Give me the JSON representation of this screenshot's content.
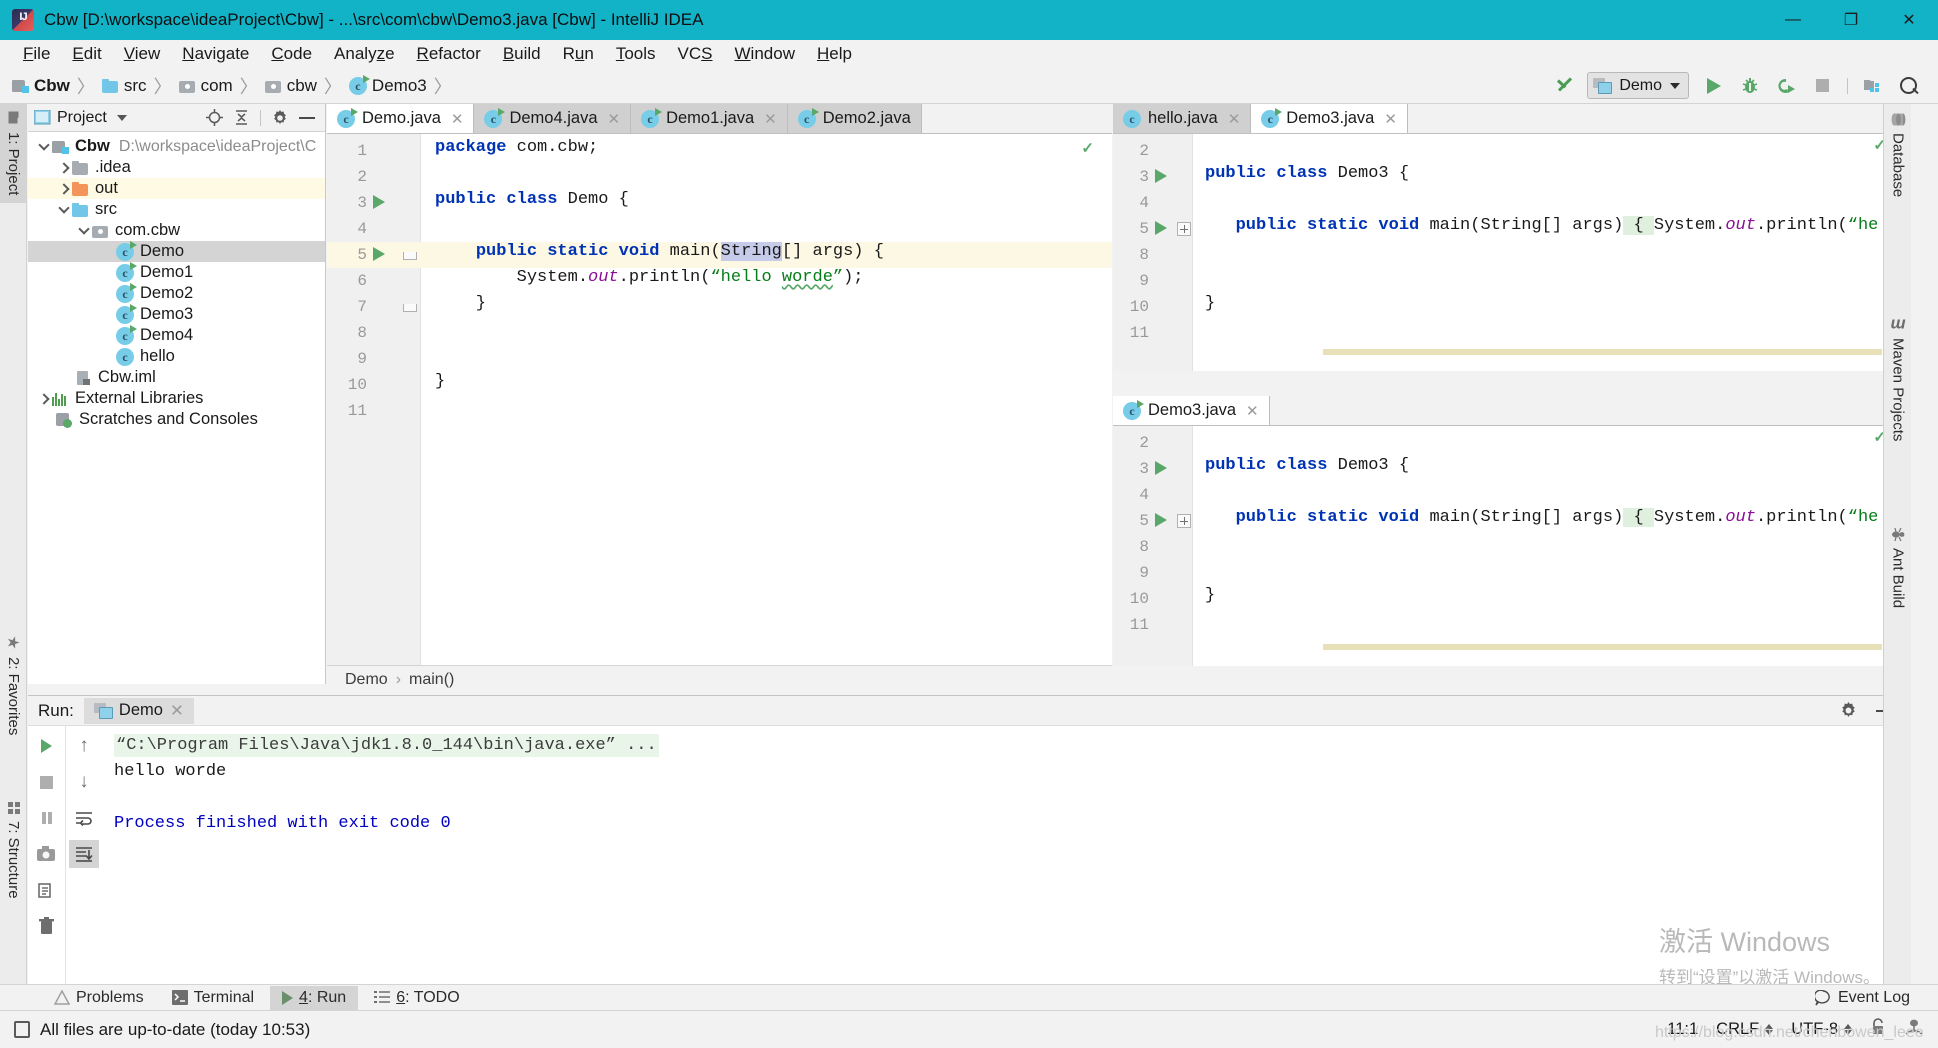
{
  "window": {
    "title": "Cbw [D:\\workspace\\ideaProject\\Cbw] - ...\\src\\com\\cbw\\Demo3.java [Cbw] - IntelliJ IDEA",
    "app_icon": "intellij-idea-icon",
    "minimize": "—",
    "maximize": "❐",
    "close": "✕",
    "titlebar_color": "#12b3c6"
  },
  "menu": {
    "items": [
      {
        "label": "File"
      },
      {
        "label": "Edit"
      },
      {
        "label": "View"
      },
      {
        "label": "Navigate"
      },
      {
        "label": "Code"
      },
      {
        "label": "Analyze"
      },
      {
        "label": "Refactor"
      },
      {
        "label": "Build"
      },
      {
        "label": "Run"
      },
      {
        "label": "Tools"
      },
      {
        "label": "VCS"
      },
      {
        "label": "Window"
      },
      {
        "label": "Help"
      }
    ]
  },
  "navbar": {
    "breadcrumbs": [
      {
        "label": "Cbw",
        "icon": "module-icon",
        "bold": true
      },
      {
        "label": "src",
        "icon": "source-folder-icon",
        "bold": false
      },
      {
        "label": "com",
        "icon": "package-icon",
        "bold": false
      },
      {
        "label": "cbw",
        "icon": "package-icon",
        "bold": false
      },
      {
        "label": "Demo3",
        "icon": "java-class-icon",
        "bold": false
      }
    ],
    "separator": "〉",
    "toolbar": {
      "update_project_label": "update-project-icon",
      "run_configuration": "Demo",
      "run_button": "run-icon",
      "debug_button": "debug-icon",
      "coverage_button": "run-with-coverage-icon",
      "stop_button": "stop-icon",
      "project_structure_button": "project-structure-icon",
      "search_button": "search-everywhere-icon"
    }
  },
  "left_tool_strip": {
    "tabs": [
      {
        "label": "1: Project",
        "icon": "project-folder-icon",
        "active": true
      },
      {
        "label": "2: Favorites",
        "icon": "star-icon",
        "active": false
      },
      {
        "label": "7: Structure",
        "icon": "structure-icon",
        "active": false
      }
    ]
  },
  "right_tool_strip": {
    "tabs": [
      {
        "label": "Database",
        "icon": "database-icon"
      },
      {
        "label": "Maven Projects",
        "icon": "maven-icon"
      },
      {
        "label": "Ant Build",
        "icon": "ant-icon"
      }
    ]
  },
  "project_panel": {
    "title": "Project",
    "dropdown_icon": "chevron-down-icon",
    "tools": [
      {
        "name": "locate-icon"
      },
      {
        "name": "collapse-all-icon"
      },
      {
        "name": "settings-gear-icon"
      },
      {
        "name": "hide-icon"
      }
    ],
    "tree": [
      {
        "label": "Cbw",
        "path": "D:\\workspace\\ideaProject\\C",
        "icon": "module-icon",
        "indent": 0,
        "twisty": "down",
        "bold": true,
        "state": "normal"
      },
      {
        "label": ".idea",
        "path": "",
        "icon": "folder-gray-icon",
        "indent": 1,
        "twisty": "right",
        "bold": false,
        "state": "normal"
      },
      {
        "label": "out",
        "path": "",
        "icon": "folder-orange-icon",
        "indent": 1,
        "twisty": "right",
        "bold": false,
        "state": "highlight"
      },
      {
        "label": "src",
        "path": "",
        "icon": "folder-blue-icon",
        "indent": 1,
        "twisty": "down",
        "bold": false,
        "state": "normal"
      },
      {
        "label": "com.cbw",
        "path": "",
        "icon": "package-icon",
        "indent": 2,
        "twisty": "down",
        "bold": false,
        "state": "normal"
      },
      {
        "label": "Demo",
        "path": "",
        "icon": "java-class-runnable-icon",
        "indent": 3,
        "twisty": "",
        "bold": false,
        "state": "selected"
      },
      {
        "label": "Demo1",
        "path": "",
        "icon": "java-class-runnable-icon",
        "indent": 3,
        "twisty": "",
        "bold": false,
        "state": "normal"
      },
      {
        "label": "Demo2",
        "path": "",
        "icon": "java-class-runnable-icon",
        "indent": 3,
        "twisty": "",
        "bold": false,
        "state": "normal"
      },
      {
        "label": "Demo3",
        "path": "",
        "icon": "java-class-runnable-icon",
        "indent": 3,
        "twisty": "",
        "bold": false,
        "state": "normal"
      },
      {
        "label": "Demo4",
        "path": "",
        "icon": "java-class-runnable-icon",
        "indent": 3,
        "twisty": "",
        "bold": false,
        "state": "normal"
      },
      {
        "label": "hello",
        "path": "",
        "icon": "java-class-icon",
        "indent": 3,
        "twisty": "",
        "bold": false,
        "state": "normal"
      },
      {
        "label": "Cbw.iml",
        "path": "",
        "icon": "iml-file-icon",
        "indent": 2,
        "twisty": "",
        "bold": false,
        "state": "normal"
      },
      {
        "label": "External Libraries",
        "path": "",
        "icon": "library-icon",
        "indent": 0,
        "twisty": "right",
        "bold": false,
        "state": "normal"
      },
      {
        "label": "Scratches and Consoles",
        "path": "",
        "icon": "scratches-icon",
        "indent": 1,
        "twisty": "",
        "bold": false,
        "state": "normal"
      }
    ]
  },
  "editor_left": {
    "tabs": [
      {
        "label": "Demo.java",
        "icon": "java-class-runnable-icon",
        "active": true,
        "close": "✕"
      },
      {
        "label": "Demo4.java",
        "icon": "java-class-runnable-icon",
        "active": false,
        "close": "✕"
      },
      {
        "label": "Demo1.java",
        "icon": "java-class-runnable-icon",
        "active": false,
        "close": "✕"
      },
      {
        "label": "Demo2.java",
        "icon": "java-class-runnable-icon",
        "active": false,
        "close": "✕"
      }
    ],
    "lines": [
      {
        "num": "1",
        "gutter_run": false,
        "fold": "",
        "highlight": false,
        "tokens": [
          {
            "t": "package",
            "c": "kw"
          },
          {
            "t": " com.cbw;",
            "c": "plain"
          }
        ]
      },
      {
        "num": "2",
        "gutter_run": false,
        "fold": "",
        "highlight": false,
        "tokens": []
      },
      {
        "num": "3",
        "gutter_run": true,
        "fold": "",
        "highlight": false,
        "tokens": [
          {
            "t": "public class",
            "c": "kw"
          },
          {
            "t": " Demo {",
            "c": "plain"
          }
        ]
      },
      {
        "num": "4",
        "gutter_run": false,
        "fold": "",
        "highlight": false,
        "tokens": []
      },
      {
        "num": "5",
        "gutter_run": true,
        "fold": "tip",
        "highlight": true,
        "tokens": [
          {
            "t": "    ",
            "c": "plain"
          },
          {
            "t": "public static void",
            "c": "kw"
          },
          {
            "t": " main(",
            "c": "plain"
          },
          {
            "t": "String",
            "c": "sel-blue"
          },
          {
            "t": "[] args) {",
            "c": "plain"
          }
        ]
      },
      {
        "num": "6",
        "gutter_run": false,
        "fold": "",
        "highlight": false,
        "tokens": [
          {
            "t": "        System.",
            "c": "plain"
          },
          {
            "t": "out",
            "c": "field-it"
          },
          {
            "t": ".println(",
            "c": "plain"
          },
          {
            "t": "“hello ",
            "c": "str"
          },
          {
            "t": "worde",
            "c": "str squiggle"
          },
          {
            "t": "”",
            "c": "str"
          },
          {
            "t": ");",
            "c": "plain"
          }
        ]
      },
      {
        "num": "7",
        "gutter_run": false,
        "fold": "tip",
        "highlight": false,
        "tokens": [
          {
            "t": "    }",
            "c": "plain"
          }
        ]
      },
      {
        "num": "8",
        "gutter_run": false,
        "fold": "",
        "highlight": false,
        "tokens": []
      },
      {
        "num": "9",
        "gutter_run": false,
        "fold": "",
        "highlight": false,
        "tokens": []
      },
      {
        "num": "10",
        "gutter_run": false,
        "fold": "",
        "highlight": false,
        "tokens": [
          {
            "t": "}",
            "c": "plain"
          }
        ]
      },
      {
        "num": "11",
        "gutter_run": false,
        "fold": "",
        "highlight": false,
        "tokens": []
      }
    ],
    "breadcrumb": [
      "Demo",
      "main()"
    ],
    "breadcrumb_separator": "›"
  },
  "editor_right_top": {
    "tabs": [
      {
        "label": "hello.java",
        "icon": "java-class-icon",
        "active": false,
        "close": "✕"
      },
      {
        "label": "Demo3.java",
        "icon": "java-class-runnable-icon",
        "active": true,
        "close": "✕"
      }
    ],
    "lines": [
      {
        "num": "2",
        "gutter_run": false,
        "fold": "",
        "tokens": []
      },
      {
        "num": "3",
        "gutter_run": true,
        "fold": "",
        "tokens": [
          {
            "t": "public class",
            "c": "kw"
          },
          {
            "t": " Demo3 {",
            "c": "plain"
          }
        ]
      },
      {
        "num": "4",
        "gutter_run": false,
        "fold": "",
        "tokens": []
      },
      {
        "num": "5",
        "gutter_run": true,
        "fold": "plus",
        "tokens": [
          {
            "t": "   ",
            "c": "plain"
          },
          {
            "t": "public static void",
            "c": "kw"
          },
          {
            "t": " main(String[] args)",
            "c": "plain"
          },
          {
            "t": " { ",
            "c": "plain brace-hl"
          },
          {
            "t": "System.",
            "c": "plain"
          },
          {
            "t": "out",
            "c": "field-it"
          },
          {
            "t": ".println(",
            "c": "plain"
          },
          {
            "t": "“he",
            "c": "str"
          }
        ]
      },
      {
        "num": "8",
        "gutter_run": false,
        "fold": "",
        "tokens": []
      },
      {
        "num": "9",
        "gutter_run": false,
        "fold": "",
        "tokens": []
      },
      {
        "num": "10",
        "gutter_run": false,
        "fold": "",
        "tokens": [
          {
            "t": "}",
            "c": "plain"
          }
        ]
      },
      {
        "num": "11",
        "gutter_run": false,
        "fold": "",
        "tokens": []
      }
    ]
  },
  "editor_right_bottom": {
    "tabs": [
      {
        "label": "Demo3.java",
        "icon": "java-class-runnable-icon",
        "active": true,
        "close": "✕"
      }
    ],
    "lines": [
      {
        "num": "2",
        "gutter_run": false,
        "fold": "",
        "tokens": []
      },
      {
        "num": "3",
        "gutter_run": true,
        "fold": "",
        "tokens": [
          {
            "t": "public class",
            "c": "kw"
          },
          {
            "t": " Demo3 {",
            "c": "plain"
          }
        ]
      },
      {
        "num": "4",
        "gutter_run": false,
        "fold": "",
        "tokens": []
      },
      {
        "num": "5",
        "gutter_run": true,
        "fold": "plus",
        "tokens": [
          {
            "t": "   ",
            "c": "plain"
          },
          {
            "t": "public static void",
            "c": "kw"
          },
          {
            "t": " main(String[] args)",
            "c": "plain"
          },
          {
            "t": " { ",
            "c": "plain brace-hl"
          },
          {
            "t": "System.",
            "c": "plain"
          },
          {
            "t": "out",
            "c": "field-it"
          },
          {
            "t": ".println(",
            "c": "plain"
          },
          {
            "t": "“he",
            "c": "str"
          }
        ]
      },
      {
        "num": "8",
        "gutter_run": false,
        "fold": "",
        "tokens": []
      },
      {
        "num": "9",
        "gutter_run": false,
        "fold": "",
        "tokens": []
      },
      {
        "num": "10",
        "gutter_run": false,
        "fold": "",
        "tokens": [
          {
            "t": "}",
            "c": "plain"
          }
        ]
      },
      {
        "num": "11",
        "gutter_run": false,
        "fold": "",
        "tokens": []
      }
    ]
  },
  "run_panel": {
    "label": "Run:",
    "tab": {
      "label": "Demo",
      "icon": "run-config-icon",
      "close": "✕"
    },
    "header_tools": [
      {
        "name": "settings-gear-icon"
      },
      {
        "name": "hide-panel-icon"
      }
    ],
    "side_buttons_col1": [
      {
        "name": "rerun-icon",
        "glyph": "play"
      },
      {
        "name": "stop-icon",
        "glyph": "stop"
      },
      {
        "name": "pause-icon",
        "glyph": "pause"
      },
      {
        "name": "print-screen-icon",
        "glyph": "camera"
      },
      {
        "name": "export-icon",
        "glyph": "export"
      },
      {
        "name": "trash-icon",
        "glyph": "trash"
      }
    ],
    "side_buttons_col2": [
      {
        "name": "up-arrow-icon",
        "glyph": "↑"
      },
      {
        "name": "down-arrow-icon",
        "glyph": "↓"
      },
      {
        "name": "soft-wrap-icon",
        "glyph": "wrap"
      },
      {
        "name": "scroll-to-end-icon",
        "glyph": "scrollend",
        "active": true
      }
    ],
    "console": [
      {
        "text": "“C:\\Program Files\\Java\\jdk1.8.0_144\\bin\\java.exe” ...",
        "style": "cmd"
      },
      {
        "text": "hello worde",
        "style": "out"
      },
      {
        "text": "",
        "style": "out"
      },
      {
        "text": "Process finished with exit code 0",
        "style": "fin"
      }
    ]
  },
  "bottom_bar": {
    "items": [
      {
        "label": "Problems",
        "icon": "warning-icon",
        "active": false
      },
      {
        "label": "Terminal",
        "icon": "terminal-icon",
        "active": false
      },
      {
        "label": "4: Run",
        "icon": "run-icon",
        "active": true
      },
      {
        "label": "6: TODO",
        "icon": "todo-icon",
        "active": false
      }
    ],
    "event_log": {
      "label": "Event Log",
      "icon": "event-log-icon"
    }
  },
  "status_bar": {
    "message": "All files are up-to-date (today 10:53)",
    "message_icon": "document-icon",
    "caret_position": "11:1",
    "line_separator": "CRLF",
    "encoding": "UTF-8",
    "lock_icon": "read-only-lock-icon",
    "inspection_icon": "inspection-hector-icon"
  },
  "watermark": {
    "line1": "激活 Windows",
    "line2": "转到“设置”以激活 Windows。",
    "url": "https://blog.csdn.net/chenbowen_leee"
  }
}
